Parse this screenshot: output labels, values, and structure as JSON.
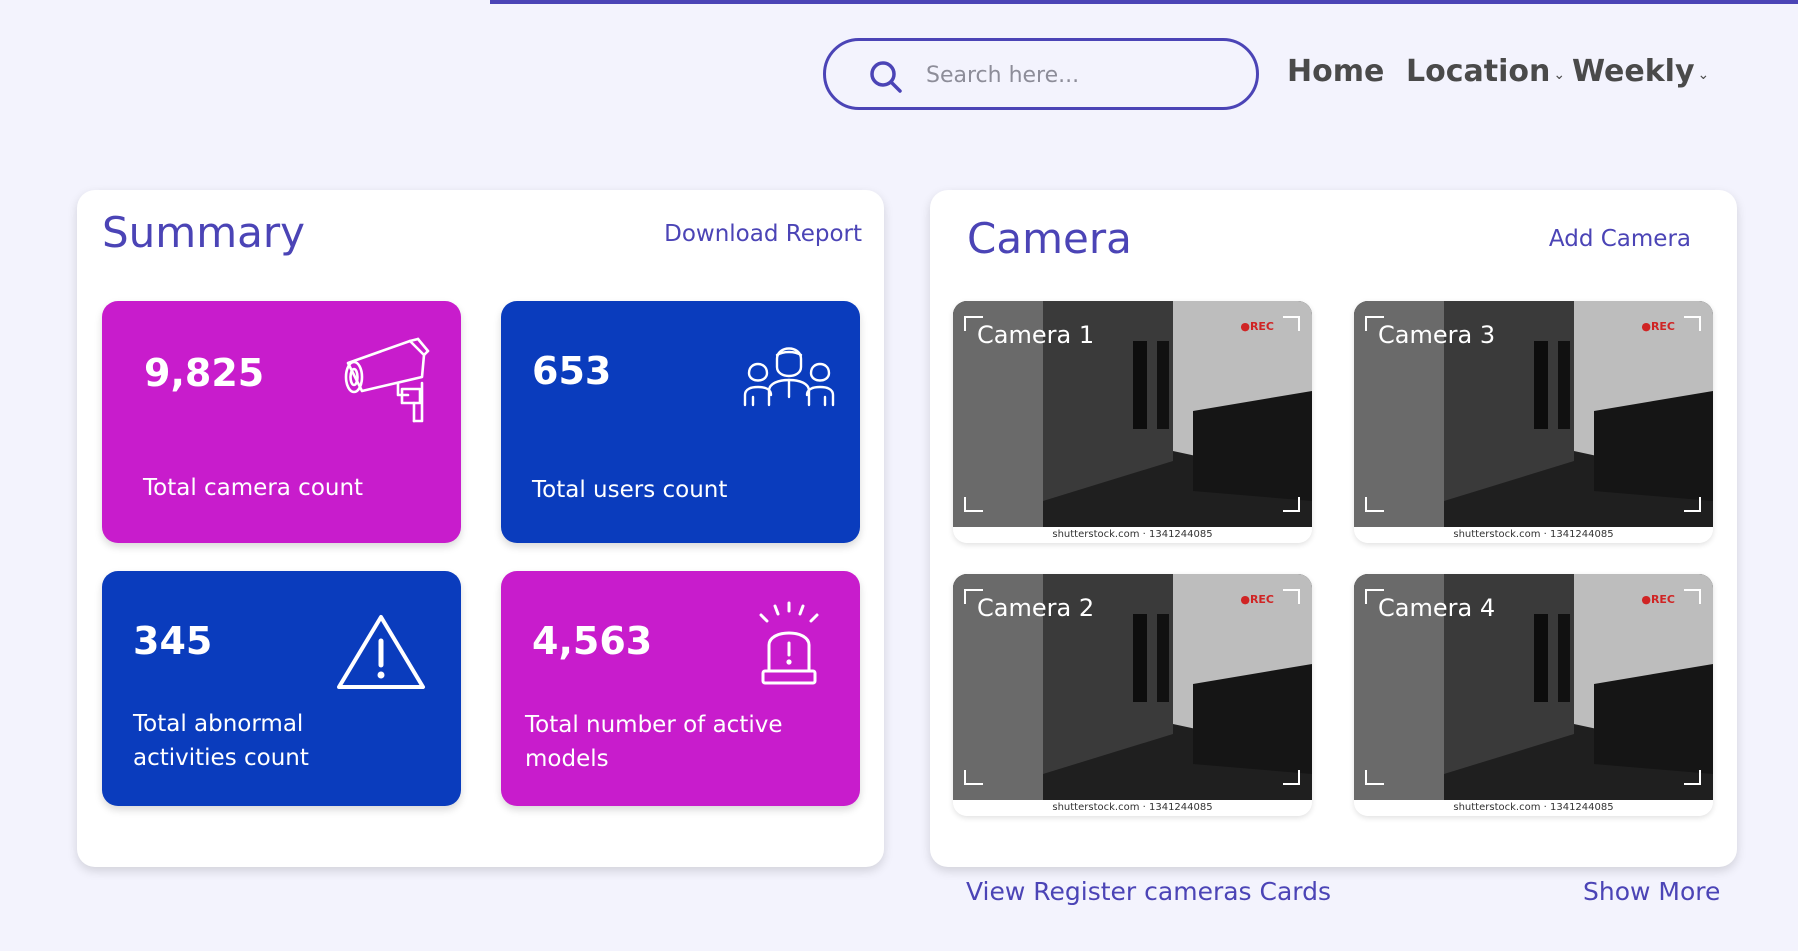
{
  "search": {
    "placeholder": "Search here..."
  },
  "nav": {
    "home": "Home",
    "location": "Location",
    "weekly": "Weekly",
    "caret": "⌄"
  },
  "summary": {
    "title": "Summary",
    "download_label": "Download Report",
    "cards": [
      {
        "value": "9,825",
        "label": "Total camera count",
        "color": "#c81ccc",
        "icon": "security-camera-icon"
      },
      {
        "value": "653",
        "label": "Total users count",
        "color": "#0a3cbd",
        "icon": "users-group-icon"
      },
      {
        "value": "345",
        "label_line1": "Total abnormal",
        "label_line2": "activities count",
        "color": "#0a3cbd",
        "icon": "warning-icon"
      },
      {
        "value": "4,563",
        "label_line1": "Total number of active",
        "label_line2": "models",
        "color": "#c81ccc",
        "icon": "alarm-siren-icon"
      }
    ]
  },
  "camera": {
    "title": "Camera",
    "add_label": "Add Camera",
    "rec_label": "●REC",
    "stock_text": "shutterstock.com · 1341244085",
    "feeds": [
      {
        "label": "Camera 1"
      },
      {
        "label": "Camera 3"
      },
      {
        "label": "Camera 2"
      },
      {
        "label": "Camera 4"
      }
    ]
  },
  "footer": {
    "view_register": "View Register cameras Cards",
    "show_more": "Show More"
  },
  "colors": {
    "accent": "#4b44b6",
    "magenta": "#c81ccc",
    "blue": "#0a3cbd",
    "background": "#f3f3fd"
  }
}
